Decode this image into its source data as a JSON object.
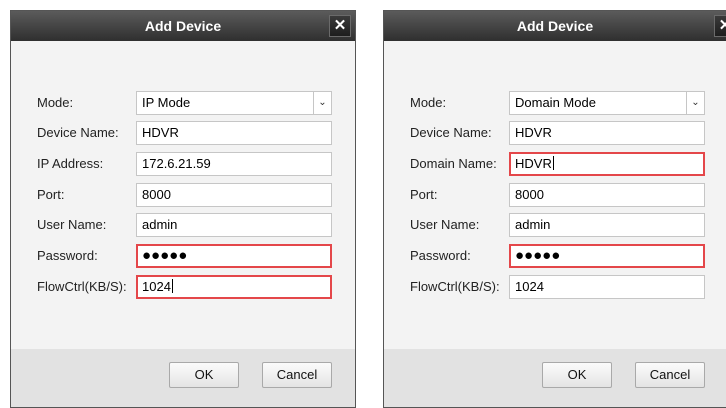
{
  "left_dialog": {
    "title": "Add Device",
    "close_symbol": "✕",
    "fields": [
      {
        "label": "Mode:",
        "value": "IP Mode"
      },
      {
        "label": "Device Name:",
        "value": "HDVR"
      },
      {
        "label": "IP Address:",
        "value": "172.6.21.59"
      },
      {
        "label": "Port:",
        "value": "8000"
      },
      {
        "label": "User Name:",
        "value": "admin"
      },
      {
        "label": "Password:",
        "value": "●●●●●"
      },
      {
        "label": "FlowCtrl(KB/S):",
        "value": "1024"
      }
    ],
    "ok_label": "OK",
    "cancel_label": "Cancel"
  },
  "right_dialog": {
    "title": "Add Device",
    "close_symbol": "✕",
    "fields": [
      {
        "label": "Mode:",
        "value": "Domain Mode"
      },
      {
        "label": "Device Name:",
        "value": "HDVR"
      },
      {
        "label": "Domain Name:",
        "value": "HDVR"
      },
      {
        "label": "Port:",
        "value": "8000"
      },
      {
        "label": "User Name:",
        "value": "admin"
      },
      {
        "label": "Password:",
        "value": "●●●●●"
      },
      {
        "label": "FlowCtrl(KB/S):",
        "value": "1024"
      }
    ],
    "ok_label": "OK",
    "cancel_label": "Cancel"
  },
  "colors": {
    "title_bar": "#3a3a3a",
    "error_border": "#e4474a",
    "dialog_bg": "#f3f3f3",
    "footer_bg": "#e2e2e2"
  },
  "icons": {
    "close": "close-icon",
    "dropdown": "chevron-down-icon"
  }
}
